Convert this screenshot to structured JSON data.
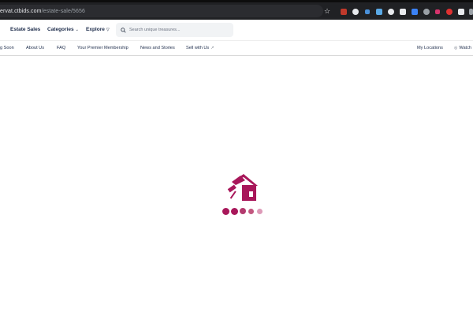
{
  "browser": {
    "url_host": "ervat.ctbids.com",
    "url_path": "/estate-sale/5656",
    "star_icon": "star-icon",
    "extension_icons": [
      "extension-icon-1",
      "extension-icon-2",
      "extension-icon-3",
      "extension-icon-4",
      "extension-icon-5",
      "extension-icon-6",
      "extension-icon-7",
      "extension-icon-8",
      "extension-icon-9",
      "extension-icon-10",
      "extension-icon-11",
      "extensions-puzzle-icon",
      "tab-search-icon"
    ]
  },
  "header": {
    "estate_sales": "Estate Sales",
    "categories": "Categories",
    "explore": "Explore",
    "search_placeholder": "Search unique treasures..."
  },
  "subnav": {
    "items": [
      "g Soon",
      "About Us",
      "FAQ",
      "Your Premier Membership",
      "News and Stories",
      "Sell with Us"
    ],
    "right": [
      "My Locations",
      "Watch"
    ]
  },
  "loader": {
    "icon": "house-gavel-icon",
    "colors": {
      "brand": "#a8175a",
      "dot_mid": "#c2577f",
      "dot_light": "#dd9ab8"
    }
  }
}
